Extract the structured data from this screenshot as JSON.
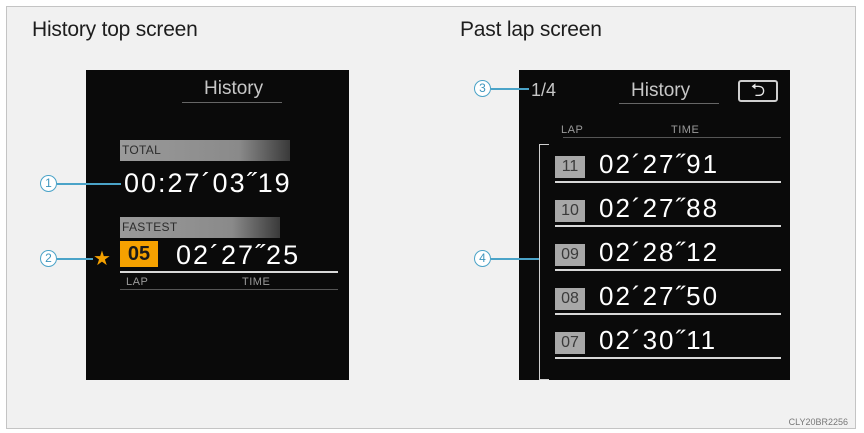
{
  "captions": {
    "left": "History top screen",
    "right": "Past lap screen"
  },
  "left_screen": {
    "title": "History",
    "total_label": "TOTAL",
    "total_time": "00:27´03˝19",
    "fastest_label": "FASTEST",
    "fastest_lap": "05",
    "fastest_time": "02´27˝25",
    "col_lap": "LAP",
    "col_time": "TIME"
  },
  "right_screen": {
    "page": "1/4",
    "title": "History",
    "back_icon": "back-arrow-icon",
    "col_lap": "LAP",
    "col_time": "TIME",
    "rows": [
      {
        "lap": "11",
        "time": "02´27˝91"
      },
      {
        "lap": "10",
        "time": "02´27˝88"
      },
      {
        "lap": "09",
        "time": "02´28˝12"
      },
      {
        "lap": "08",
        "time": "02´27˝50"
      },
      {
        "lap": "07",
        "time": "02´30˝11"
      }
    ]
  },
  "callouts": [
    "1",
    "2",
    "3",
    "4"
  ],
  "image_code": "CLY20BR2256",
  "colors": {
    "accent": "#f5a100",
    "callout": "#4aa3c8",
    "screen_bg": "#0a0a0a"
  }
}
